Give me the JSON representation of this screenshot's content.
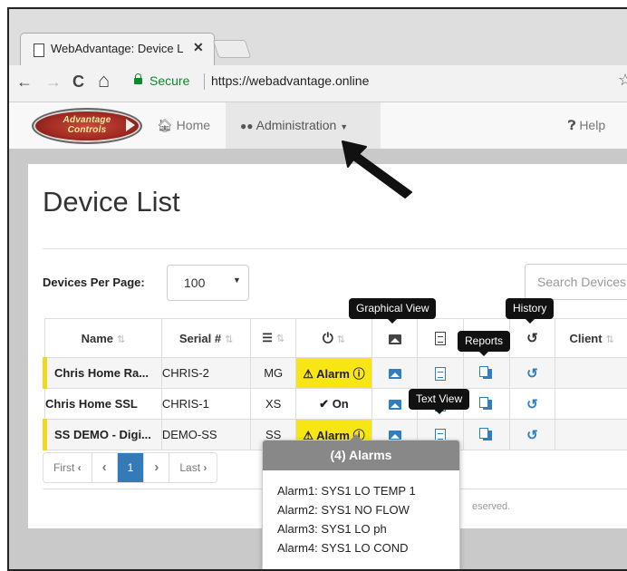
{
  "browser": {
    "tab_title": "WebAdvantage: Device L",
    "tab_close": "✕",
    "back": "←",
    "forward": "→",
    "reload": "C",
    "home": "⌂",
    "secure_label": "Secure",
    "url": "https://webadvantage.online",
    "star": "☆"
  },
  "navbar": {
    "logo_text_1": "Advantage",
    "logo_text_2": "Controls",
    "home": "Home",
    "administration": "Administration",
    "help": "Help"
  },
  "page": {
    "title": "Device List",
    "devices_per_page_label": "Devices Per Page:",
    "devices_per_page_value": "100",
    "search_placeholder": "Search Devices"
  },
  "table": {
    "headers": {
      "name": "Name",
      "serial": "Serial #",
      "client": "Client"
    },
    "rows": [
      {
        "name": "Chris Home Ra...",
        "serial": "CHRIS-2",
        "type": "MG",
        "status": "Alarm",
        "status_kind": "alarm",
        "warn": true
      },
      {
        "name": "Chris Home SSL",
        "serial": "CHRIS-1",
        "type": "XS",
        "status": "On",
        "status_kind": "ok",
        "warn": false
      },
      {
        "name": "SS DEMO - Digi...",
        "serial": "DEMO-SS",
        "type": "SS",
        "status": "Alarm",
        "status_kind": "alarm",
        "warn": true
      }
    ]
  },
  "tooltips": {
    "graphical_view": "Graphical View",
    "history": "History",
    "reports": "Reports",
    "text_view": "Text View"
  },
  "pagination": {
    "first": "First",
    "prev": "‹",
    "current": "1",
    "next": "›",
    "last": "Last"
  },
  "footer": {
    "text": "eserved."
  },
  "alarms_popover": {
    "title": "(4) Alarms",
    "items": [
      "Alarm1: SYS1 LO TEMP 1",
      "Alarm2: SYS1 NO FLOW",
      "Alarm3: SYS1 LO ph",
      "Alarm4: SYS1 LO COND"
    ]
  },
  "colors": {
    "alarm_bg": "#f8e614",
    "alarm_text": "#d42020",
    "ok": "#1a8c2a",
    "icon_blue": "#2f7fc0",
    "page_active": "#337ab7"
  }
}
